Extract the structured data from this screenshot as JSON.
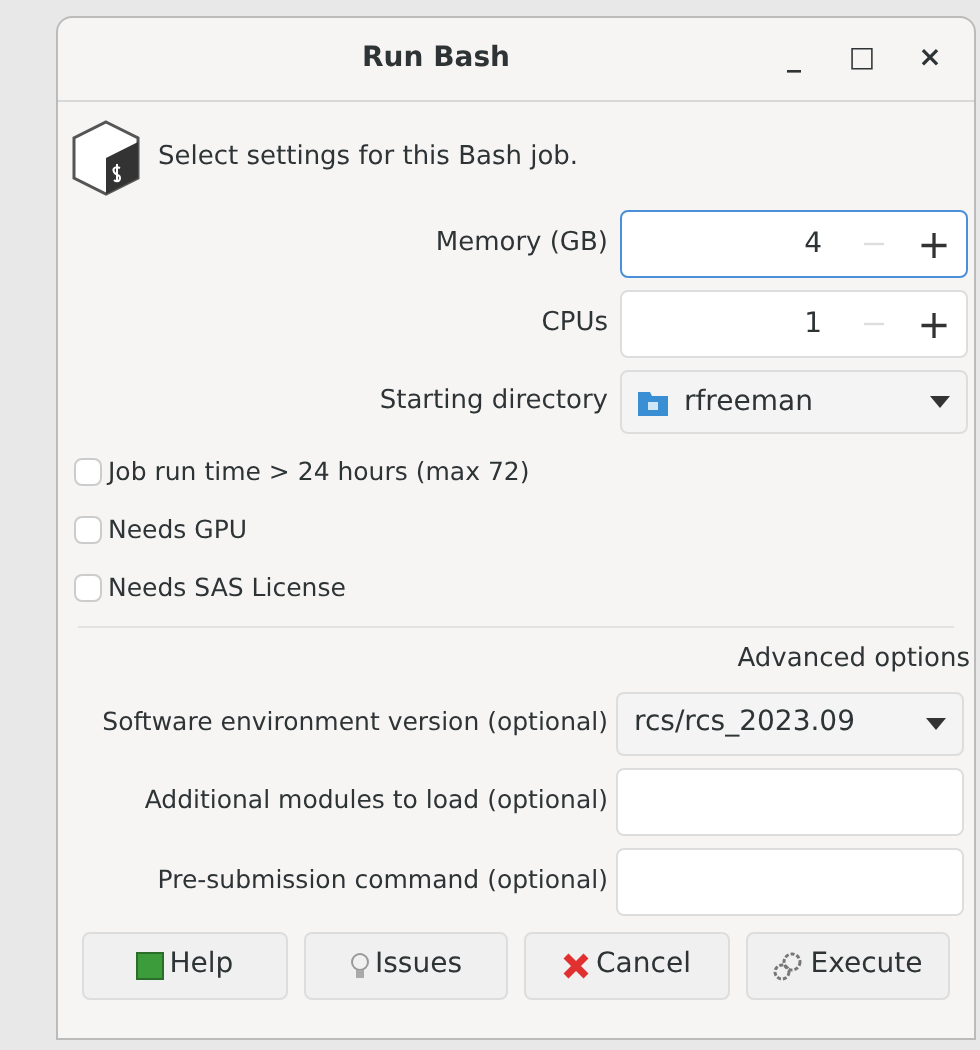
{
  "window": {
    "title": "Run Bash",
    "controls": [
      "_",
      "□",
      "×"
    ]
  },
  "header": {
    "text": "Select settings for this Bash job."
  },
  "basic_fields": [
    {
      "kind": "spin",
      "label": "Memory (GB)",
      "value": "4",
      "focused": true,
      "decrement_disabled": true,
      "increment": "+"
    },
    {
      "kind": "spin",
      "label": "CPUs",
      "value": "1",
      "focused": false,
      "decrement_disabled": true,
      "increment": "+"
    },
    {
      "kind": "folder",
      "label": "Starting directory",
      "value": "rfreeman"
    }
  ],
  "checkboxes": [
    {
      "label": "Job run time > 24 hours (max 72)",
      "checked": false
    },
    {
      "label": "Needs GPU",
      "checked": false
    },
    {
      "label": "Needs SAS License",
      "checked": false
    }
  ],
  "advanced": {
    "title": "Advanced options",
    "fields": [
      {
        "kind": "dropdown",
        "label": "Software environment version (optional)",
        "value": "rcs/rcs_2023.09"
      },
      {
        "kind": "text",
        "label": "Additional modules to load (optional)"
      },
      {
        "kind": "text",
        "label": "Pre-submission command (optional)"
      }
    ]
  },
  "buttons": [
    {
      "label": "Help"
    },
    {
      "label": "Issues"
    },
    {
      "label": "Cancel"
    },
    {
      "label": "Execute"
    }
  ]
}
